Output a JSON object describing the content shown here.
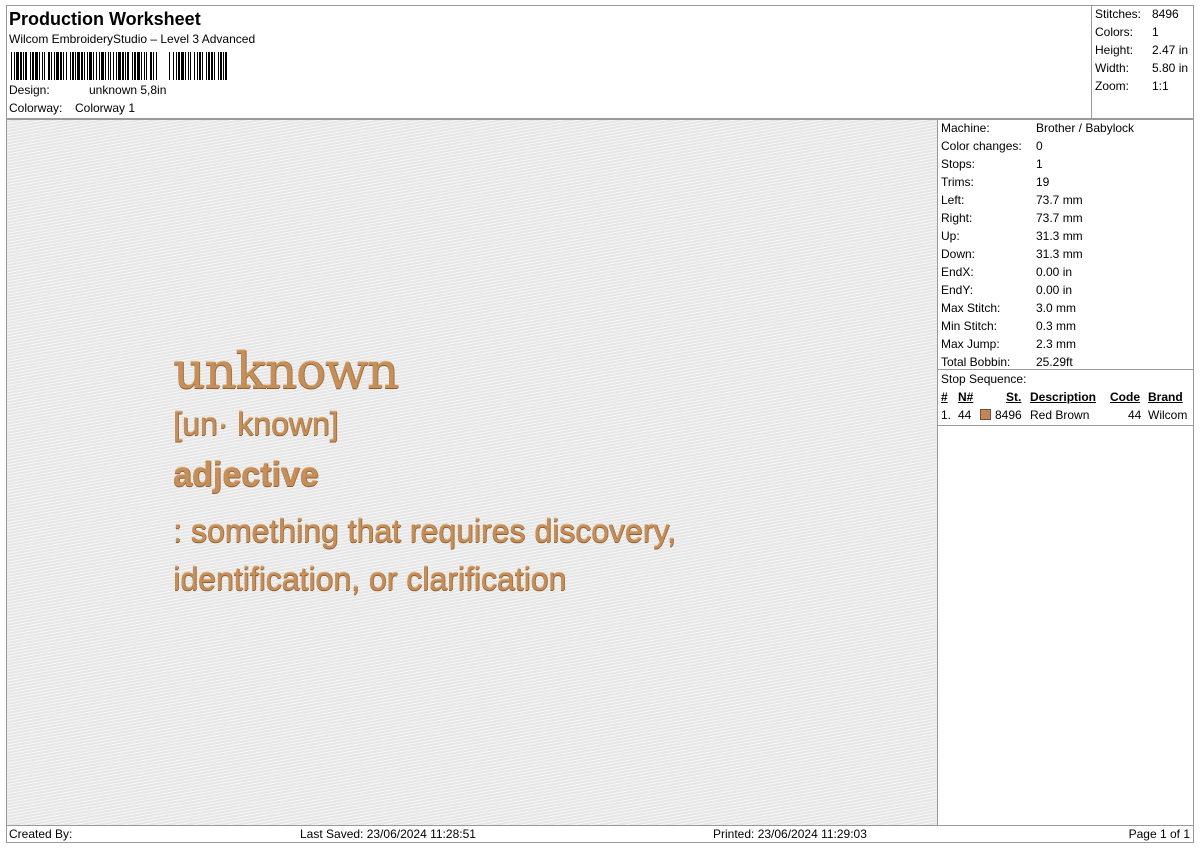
{
  "header": {
    "title": "Production Worksheet",
    "app": "Wilcom EmbroideryStudio – Level 3 Advanced",
    "barcode_icon": "barcode-icon",
    "design_label": "Design:",
    "design_value": "unknown 5,8in",
    "colorway_label": "Colorway:",
    "colorway_value": "Colorway 1"
  },
  "summary": [
    {
      "label": "Stitches:",
      "value": "8496"
    },
    {
      "label": "Colors:",
      "value": "1"
    },
    {
      "label": "Height:",
      "value": "2.47 in"
    },
    {
      "label": "Width:",
      "value": "5.80 in"
    },
    {
      "label": "Zoom:",
      "value": "1:1"
    }
  ],
  "design_text": {
    "word": "unknown",
    "pronunciation": "[un· known]",
    "part_of_speech": "adjective",
    "definition_line1": ": something that requires discovery,",
    "definition_line2": "identification, or clarification",
    "thread_color": "#c48f5b"
  },
  "machine_stats": [
    {
      "label": "Machine:",
      "value": "Brother / Babylock"
    },
    {
      "label": "Color changes:",
      "value": "0"
    },
    {
      "label": "Stops:",
      "value": "1"
    },
    {
      "label": "Trims:",
      "value": "19"
    },
    {
      "label": "Left:",
      "value": "73.7 mm"
    },
    {
      "label": "Right:",
      "value": "73.7 mm"
    },
    {
      "label": "Up:",
      "value": "31.3 mm"
    },
    {
      "label": "Down:",
      "value": "31.3 mm"
    },
    {
      "label": "EndX:",
      "value": "0.00 in"
    },
    {
      "label": "EndY:",
      "value": "0.00 in"
    },
    {
      "label": "Max Stitch:",
      "value": "3.0 mm"
    },
    {
      "label": "Min Stitch:",
      "value": "0.3 mm"
    },
    {
      "label": "Max Jump:",
      "value": "2.3 mm"
    },
    {
      "label": "Total Bobbin:",
      "value": "25.29ft"
    }
  ],
  "stop_sequence": {
    "title": "Stop Sequence:",
    "headers": {
      "index": "#",
      "needle": "N#",
      "stitches": "St.",
      "description": "Description",
      "code": "Code",
      "brand": "Brand"
    },
    "rows": [
      {
        "index": "1.",
        "needle": "44",
        "swatch_color": "#c0875a",
        "stitches": "8496",
        "description": "Red Brown",
        "code": "44",
        "brand": "Wilcom"
      }
    ]
  },
  "footer": {
    "created_by": "Created By:",
    "last_saved": "Last Saved: 23/06/2024 11:28:51",
    "printed": "Printed: 23/06/2024 11:29:03",
    "page": "Page 1 of 1"
  }
}
